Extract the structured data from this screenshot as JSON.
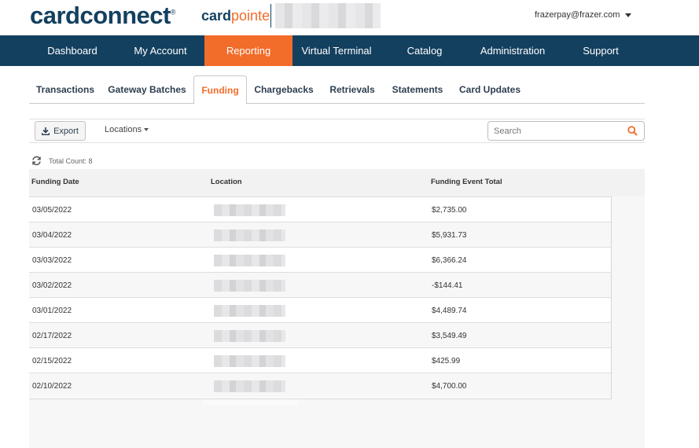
{
  "header": {
    "brand": "cardconnect",
    "brand_tm": "®",
    "product_card": "card",
    "product_pointe": "pointe",
    "user_email": "frazerpay@frazer.com"
  },
  "nav": {
    "items": [
      {
        "label": "Dashboard"
      },
      {
        "label": "My Account"
      },
      {
        "label": "Reporting"
      },
      {
        "label": "Virtual Terminal"
      },
      {
        "label": "Catalog"
      },
      {
        "label": "Administration"
      },
      {
        "label": "Support"
      }
    ],
    "active": "Reporting"
  },
  "subtabs": {
    "items": [
      {
        "label": "Transactions"
      },
      {
        "label": "Gateway Batches"
      },
      {
        "label": "Funding"
      },
      {
        "label": "Chargebacks"
      },
      {
        "label": "Retrievals"
      },
      {
        "label": "Statements"
      },
      {
        "label": "Card Updates"
      }
    ],
    "active": "Funding"
  },
  "toolbar": {
    "export_label": "Export",
    "locations_label": "Locations",
    "search_placeholder": "Search"
  },
  "table": {
    "total_count_label": "Total Count: 8",
    "columns": [
      "Funding Date",
      "Location",
      "Funding Event Total"
    ],
    "rows": [
      {
        "date": "03/05/2022",
        "total": "$2,735.00"
      },
      {
        "date": "03/04/2022",
        "total": "$5,931.73"
      },
      {
        "date": "03/03/2022",
        "total": "$6,366.24"
      },
      {
        "date": "03/02/2022",
        "total": "-$144.41"
      },
      {
        "date": "03/01/2022",
        "total": "$4,489.74"
      },
      {
        "date": "02/17/2022",
        "total": "$3,549.49"
      },
      {
        "date": "02/15/2022",
        "total": "$425.99"
      },
      {
        "date": "02/10/2022",
        "total": "$4,700.00"
      }
    ]
  },
  "colors": {
    "navy": "#14405f",
    "orange": "#f26c2a"
  },
  "icons": [
    "caret-down-icon",
    "download-icon",
    "search-icon",
    "refresh-icon"
  ]
}
